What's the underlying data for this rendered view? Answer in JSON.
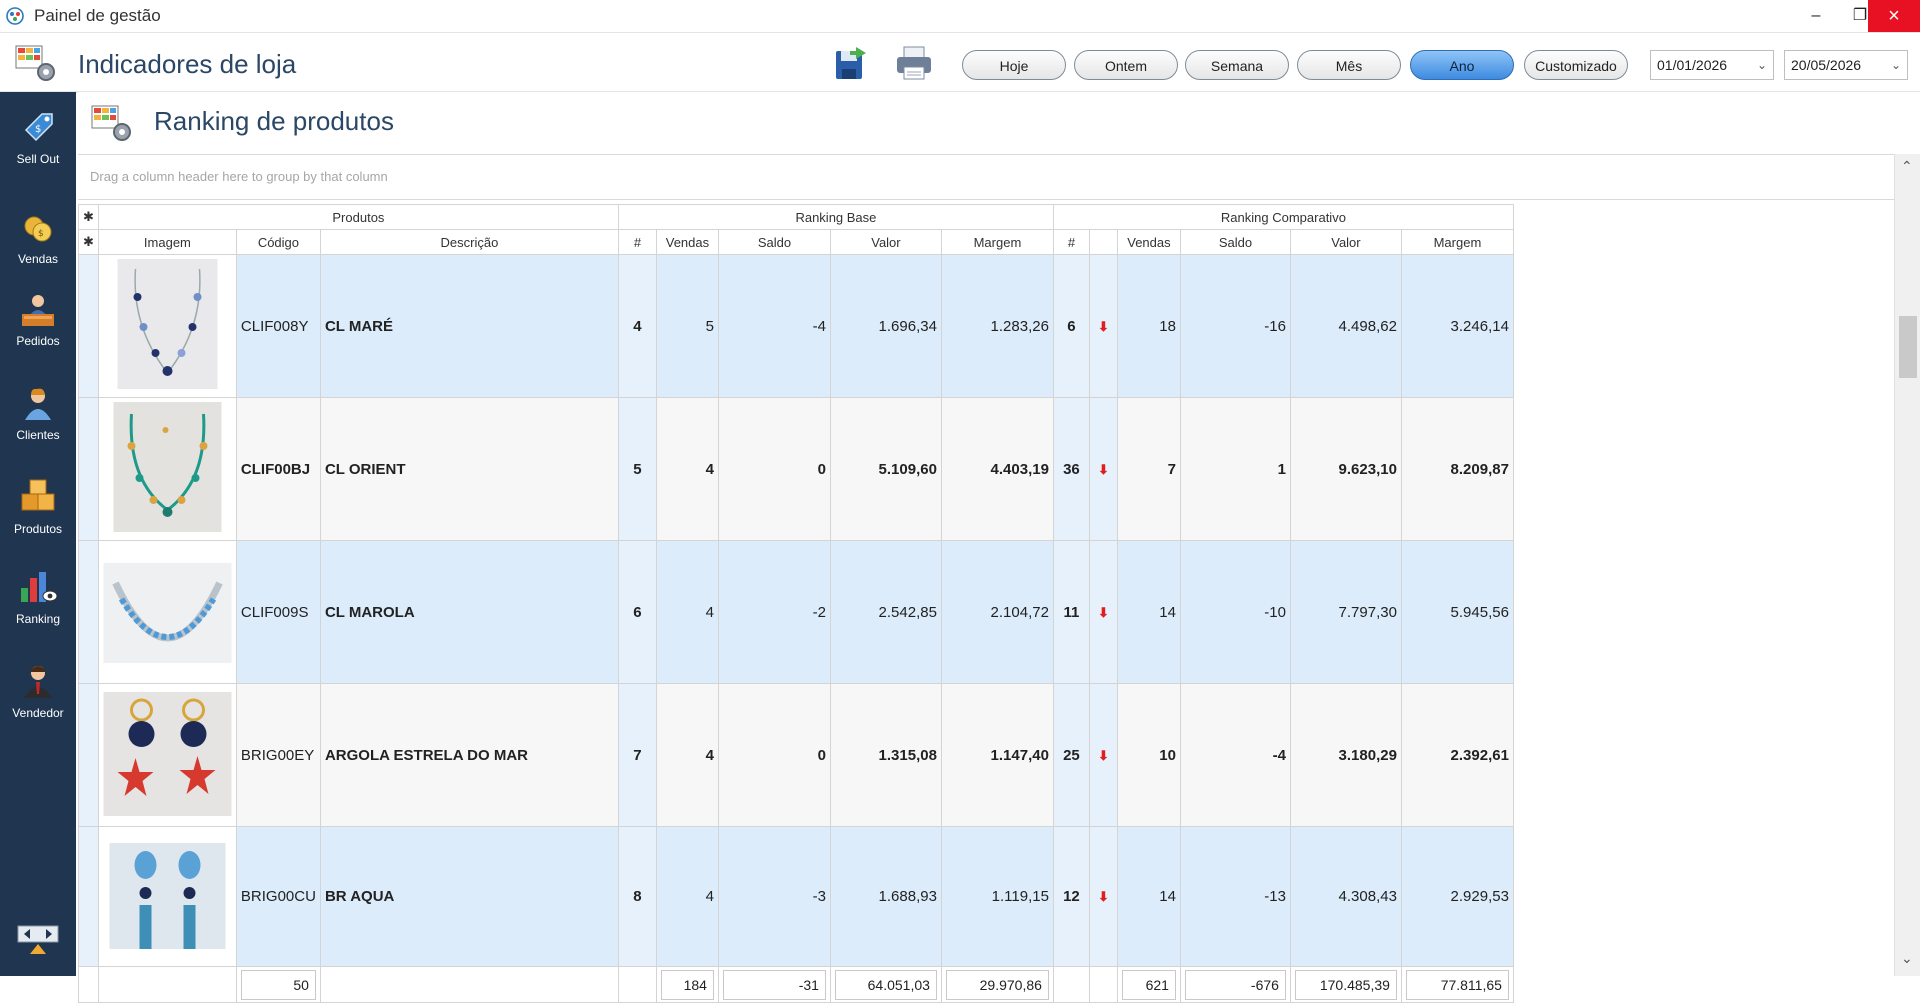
{
  "window": {
    "title": "Painel de gestão"
  },
  "header": {
    "title": "Indicadores de loja",
    "period_buttons": [
      "Hoje",
      "Ontem",
      "Semana",
      "Mês",
      "Ano",
      "Customizado"
    ],
    "active_period": "Ano",
    "date_from": "01/01/2026",
    "date_to": "20/05/2026"
  },
  "sidebar": {
    "items": [
      {
        "label": "Sell Out",
        "icon": "price-tag-icon"
      },
      {
        "label": "Vendas",
        "icon": "coins-icon"
      },
      {
        "label": "Pedidos",
        "icon": "desk-clerk-icon"
      },
      {
        "label": "Clientes",
        "icon": "customer-icon"
      },
      {
        "label": "Produtos",
        "icon": "boxes-icon"
      },
      {
        "label": "Ranking",
        "icon": "bar-chart-eye-icon"
      },
      {
        "label": "Vendedor",
        "icon": "salesman-icon"
      }
    ]
  },
  "section": {
    "title": "Ranking de produtos"
  },
  "grid": {
    "group_hint": "Drag a column header here to group by that column",
    "bands": {
      "produtos": "Produtos",
      "base": "Ranking Base",
      "comparativo": "Ranking Comparativo"
    },
    "columns": {
      "imagem": "Imagem",
      "codigo": "Código",
      "descricao": "Descrição",
      "rank": "#",
      "vendas": "Vendas",
      "saldo": "Saldo",
      "valor": "Valor",
      "margem": "Margem",
      "comp_rank": "#",
      "comp_vendas": "Vendas",
      "comp_saldo": "Saldo",
      "comp_valor": "Valor",
      "comp_margem": "Margem"
    },
    "rows": [
      {
        "codigo": "CLIF008Y",
        "descricao": "CL MARÉ",
        "rank": "4",
        "vendas": "5",
        "saldo": "-4",
        "valor": "1.696,34",
        "margem": "1.283,26",
        "comp_rank": "6",
        "comp_vendas": "18",
        "comp_saldo": "-16",
        "comp_valor": "4.498,62",
        "comp_margem": "3.246,14",
        "bold": false
      },
      {
        "codigo": "CLIF00BJ",
        "descricao": "CL ORIENT",
        "rank": "5",
        "vendas": "4",
        "saldo": "0",
        "valor": "5.109,60",
        "margem": "4.403,19",
        "comp_rank": "36",
        "comp_vendas": "7",
        "comp_saldo": "1",
        "comp_valor": "9.623,10",
        "comp_margem": "8.209,87",
        "bold": true
      },
      {
        "codigo": "CLIF009S",
        "descricao": "CL MAROLA",
        "rank": "6",
        "vendas": "4",
        "saldo": "-2",
        "valor": "2.542,85",
        "margem": "2.104,72",
        "comp_rank": "11",
        "comp_vendas": "14",
        "comp_saldo": "-10",
        "comp_valor": "7.797,30",
        "comp_margem": "5.945,56",
        "bold": false
      },
      {
        "codigo": "BRIG00EY",
        "descricao": "ARGOLA ESTRELA DO MAR",
        "rank": "7",
        "vendas": "4",
        "saldo": "0",
        "valor": "1.315,08",
        "margem": "1.147,40",
        "comp_rank": "25",
        "comp_vendas": "10",
        "comp_saldo": "-4",
        "comp_valor": "3.180,29",
        "comp_margem": "2.392,61",
        "bold": true
      },
      {
        "codigo": "BRIG00CU",
        "descricao": "BR AQUA",
        "rank": "8",
        "vendas": "4",
        "saldo": "-3",
        "valor": "1.688,93",
        "margem": "1.119,15",
        "comp_rank": "12",
        "comp_vendas": "14",
        "comp_saldo": "-13",
        "comp_valor": "4.308,43",
        "comp_margem": "2.929,53",
        "bold": false
      }
    ],
    "totals": {
      "codigo": "50",
      "vendas": "184",
      "saldo": "-31",
      "valor": "64.051,03",
      "margem": "29.970,86",
      "comp_vendas": "621",
      "comp_saldo": "-676",
      "comp_valor": "170.485,39",
      "comp_margem": "77.811,65"
    }
  },
  "colors": {
    "sidebar": "#1f3550",
    "row_blue": "#dcecfb",
    "down_arrow": "#e21d1d",
    "active_button": "#3e8be0"
  }
}
